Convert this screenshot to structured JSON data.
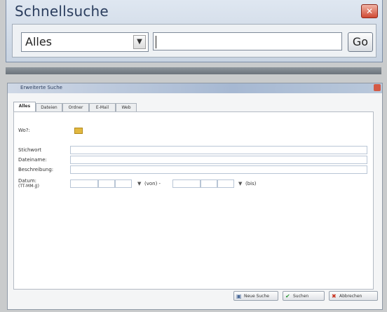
{
  "quicksearch": {
    "title": "Schnellsuche",
    "close_glyph": "✕",
    "selected_option": "Alles",
    "search_value": "",
    "go_label": "Go"
  },
  "advanced": {
    "title": "Erweiterte Suche",
    "tabs": [
      "Alles",
      "Dateien",
      "Ordner",
      "E-Mail",
      "Web"
    ],
    "labels": {
      "where": "Wo?:",
      "keyword": "Stichwort",
      "filename": "Dateiname:",
      "description": "Beschreibung:",
      "date": "Datum:",
      "date_format": "(TT-MM-JJ)",
      "from": "(von) -",
      "to": "(bis)"
    },
    "buttons": {
      "new_search": "Neue Suche",
      "search": "Suchen",
      "cancel": "Abbrechen"
    }
  },
  "colors": {
    "accent": "#2b3e5e",
    "close": "#d04a33",
    "folder": "#e2b840"
  }
}
